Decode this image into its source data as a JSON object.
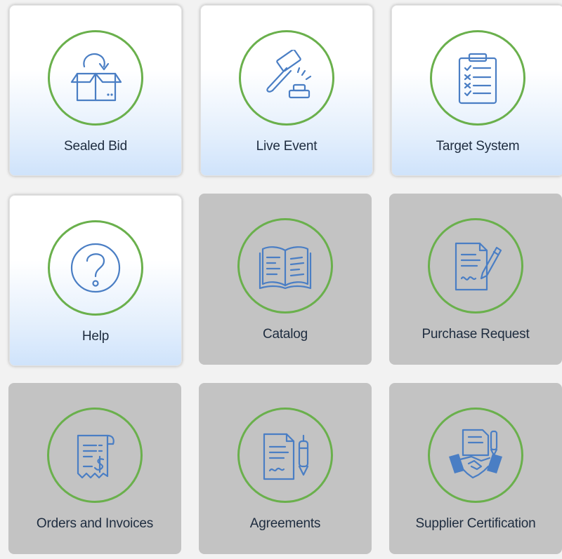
{
  "tiles": [
    {
      "label": "Sealed Bid",
      "icon": "box-arrow-icon",
      "state": "active"
    },
    {
      "label": "Live Event",
      "icon": "gavel-icon",
      "state": "active"
    },
    {
      "label": "Target System",
      "icon": "clipboard-checklist-icon",
      "state": "active"
    },
    {
      "label": "Help",
      "icon": "question-mark-icon",
      "state": "active"
    },
    {
      "label": "Catalog",
      "icon": "open-book-icon",
      "state": "disabled"
    },
    {
      "label": "Purchase Request",
      "icon": "document-pen-icon",
      "state": "disabled"
    },
    {
      "label": "Orders and Invoices",
      "icon": "receipt-dollar-icon",
      "state": "disabled"
    },
    {
      "label": "Agreements",
      "icon": "contract-pen-icon",
      "state": "disabled"
    },
    {
      "label": "Supplier Certification",
      "icon": "handshake-icon",
      "state": "disabled"
    }
  ],
  "colors": {
    "ring": "#6ab04c",
    "icon_stroke": "#4a7ec4",
    "disabled_tile": "#c3c3c3",
    "active_gradient_bottom": "#cfe3fb",
    "label_text": "#1e2c3f"
  }
}
